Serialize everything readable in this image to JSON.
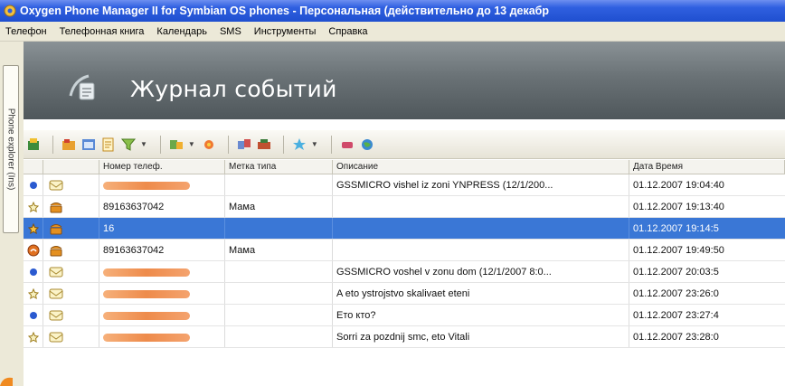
{
  "window": {
    "title": "Oxygen Phone Manager II for Symbian OS phones - Персональная (действительно до 13 декабр"
  },
  "menu": [
    {
      "label": "Телефон"
    },
    {
      "label": "Телефонная книга"
    },
    {
      "label": "Календарь"
    },
    {
      "label": "SMS"
    },
    {
      "label": "Инструменты"
    },
    {
      "label": "Справка"
    }
  ],
  "side_tab": {
    "label": "Phone explorer (Ins)"
  },
  "banner": {
    "title": "Журнал событий"
  },
  "table": {
    "columns": [
      "",
      "",
      "Номер телеф.",
      "Метка типа",
      "Описание",
      "Дата Время"
    ],
    "rows": [
      {
        "number": "",
        "label": "",
        "description": "GSSMICRO vishel iz zoni YNPRESS (12/1/200...",
        "datetime": "01.12.2007 19:04:40"
      },
      {
        "number": "89163637042",
        "label": "Мама",
        "description": "",
        "datetime": "01.12.2007 19:13:40"
      },
      {
        "number": "16",
        "label": "",
        "description": "",
        "datetime": "01.12.2007 19:14:5"
      },
      {
        "number": "89163637042",
        "label": "Мама",
        "description": "",
        "datetime": "01.12.2007 19:49:50"
      },
      {
        "number": "",
        "label": "",
        "description": "GSSMICRO voshel v zonu dom (12/1/2007 8:0...",
        "datetime": "01.12.2007 20:03:5"
      },
      {
        "number": "",
        "label": "",
        "description": "A eto ystrojstvo skalivaet eteni",
        "datetime": "01.12.2007 23:26:0"
      },
      {
        "number": "",
        "label": "",
        "description": "Ето кто?",
        "datetime": "01.12.2007 23:27:4"
      },
      {
        "number": "",
        "label": "",
        "description": "Sorri za pozdnij smc, eto Vitali",
        "datetime": "01.12.2007 23:28:0"
      }
    ]
  },
  "colors": {
    "title_bar": "#2f5fe0",
    "selection": "#3a77d6",
    "banner": "#6a7276",
    "redacted_number": "#ee8b4b"
  },
  "icons": {
    "status": [
      "sms-status-icon",
      "call-status-icon",
      "call-status-icon",
      "missed-call-icon",
      "sms-status-icon",
      "call-status-icon",
      "sms-status-icon",
      "call-status-icon"
    ],
    "type": [
      "sms-envelope-icon",
      "phone-icon",
      "phone-icon",
      "phone-icon",
      "sms-envelope-icon",
      "sms-envelope-icon",
      "sms-envelope-icon",
      "sms-envelope-icon"
    ]
  }
}
